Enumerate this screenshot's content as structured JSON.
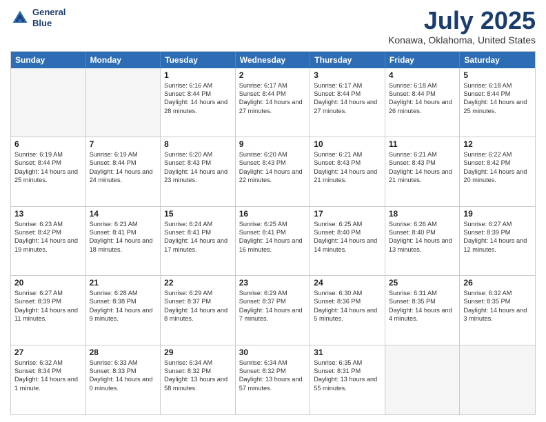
{
  "header": {
    "logo_line1": "General",
    "logo_line2": "Blue",
    "main_title": "July 2025",
    "subtitle": "Konawa, Oklahoma, United States"
  },
  "calendar": {
    "days_of_week": [
      "Sunday",
      "Monday",
      "Tuesday",
      "Wednesday",
      "Thursday",
      "Friday",
      "Saturday"
    ],
    "rows": [
      [
        {
          "day": "",
          "empty": true
        },
        {
          "day": "",
          "empty": true
        },
        {
          "day": "1",
          "sunrise": "Sunrise: 6:16 AM",
          "sunset": "Sunset: 8:44 PM",
          "daylight": "Daylight: 14 hours and 28 minutes."
        },
        {
          "day": "2",
          "sunrise": "Sunrise: 6:17 AM",
          "sunset": "Sunset: 8:44 PM",
          "daylight": "Daylight: 14 hours and 27 minutes."
        },
        {
          "day": "3",
          "sunrise": "Sunrise: 6:17 AM",
          "sunset": "Sunset: 8:44 PM",
          "daylight": "Daylight: 14 hours and 27 minutes."
        },
        {
          "day": "4",
          "sunrise": "Sunrise: 6:18 AM",
          "sunset": "Sunset: 8:44 PM",
          "daylight": "Daylight: 14 hours and 26 minutes."
        },
        {
          "day": "5",
          "sunrise": "Sunrise: 6:18 AM",
          "sunset": "Sunset: 8:44 PM",
          "daylight": "Daylight: 14 hours and 25 minutes."
        }
      ],
      [
        {
          "day": "6",
          "sunrise": "Sunrise: 6:19 AM",
          "sunset": "Sunset: 8:44 PM",
          "daylight": "Daylight: 14 hours and 25 minutes."
        },
        {
          "day": "7",
          "sunrise": "Sunrise: 6:19 AM",
          "sunset": "Sunset: 8:44 PM",
          "daylight": "Daylight: 14 hours and 24 minutes."
        },
        {
          "day": "8",
          "sunrise": "Sunrise: 6:20 AM",
          "sunset": "Sunset: 8:43 PM",
          "daylight": "Daylight: 14 hours and 23 minutes."
        },
        {
          "day": "9",
          "sunrise": "Sunrise: 6:20 AM",
          "sunset": "Sunset: 8:43 PM",
          "daylight": "Daylight: 14 hours and 22 minutes."
        },
        {
          "day": "10",
          "sunrise": "Sunrise: 6:21 AM",
          "sunset": "Sunset: 8:43 PM",
          "daylight": "Daylight: 14 hours and 21 minutes."
        },
        {
          "day": "11",
          "sunrise": "Sunrise: 6:21 AM",
          "sunset": "Sunset: 8:43 PM",
          "daylight": "Daylight: 14 hours and 21 minutes."
        },
        {
          "day": "12",
          "sunrise": "Sunrise: 6:22 AM",
          "sunset": "Sunset: 8:42 PM",
          "daylight": "Daylight: 14 hours and 20 minutes."
        }
      ],
      [
        {
          "day": "13",
          "sunrise": "Sunrise: 6:23 AM",
          "sunset": "Sunset: 8:42 PM",
          "daylight": "Daylight: 14 hours and 19 minutes."
        },
        {
          "day": "14",
          "sunrise": "Sunrise: 6:23 AM",
          "sunset": "Sunset: 8:41 PM",
          "daylight": "Daylight: 14 hours and 18 minutes."
        },
        {
          "day": "15",
          "sunrise": "Sunrise: 6:24 AM",
          "sunset": "Sunset: 8:41 PM",
          "daylight": "Daylight: 14 hours and 17 minutes."
        },
        {
          "day": "16",
          "sunrise": "Sunrise: 6:25 AM",
          "sunset": "Sunset: 8:41 PM",
          "daylight": "Daylight: 14 hours and 16 minutes."
        },
        {
          "day": "17",
          "sunrise": "Sunrise: 6:25 AM",
          "sunset": "Sunset: 8:40 PM",
          "daylight": "Daylight: 14 hours and 14 minutes."
        },
        {
          "day": "18",
          "sunrise": "Sunrise: 6:26 AM",
          "sunset": "Sunset: 8:40 PM",
          "daylight": "Daylight: 14 hours and 13 minutes."
        },
        {
          "day": "19",
          "sunrise": "Sunrise: 6:27 AM",
          "sunset": "Sunset: 8:39 PM",
          "daylight": "Daylight: 14 hours and 12 minutes."
        }
      ],
      [
        {
          "day": "20",
          "sunrise": "Sunrise: 6:27 AM",
          "sunset": "Sunset: 8:39 PM",
          "daylight": "Daylight: 14 hours and 11 minutes."
        },
        {
          "day": "21",
          "sunrise": "Sunrise: 6:28 AM",
          "sunset": "Sunset: 8:38 PM",
          "daylight": "Daylight: 14 hours and 9 minutes."
        },
        {
          "day": "22",
          "sunrise": "Sunrise: 6:29 AM",
          "sunset": "Sunset: 8:37 PM",
          "daylight": "Daylight: 14 hours and 8 minutes."
        },
        {
          "day": "23",
          "sunrise": "Sunrise: 6:29 AM",
          "sunset": "Sunset: 8:37 PM",
          "daylight": "Daylight: 14 hours and 7 minutes."
        },
        {
          "day": "24",
          "sunrise": "Sunrise: 6:30 AM",
          "sunset": "Sunset: 8:36 PM",
          "daylight": "Daylight: 14 hours and 5 minutes."
        },
        {
          "day": "25",
          "sunrise": "Sunrise: 6:31 AM",
          "sunset": "Sunset: 8:35 PM",
          "daylight": "Daylight: 14 hours and 4 minutes."
        },
        {
          "day": "26",
          "sunrise": "Sunrise: 6:32 AM",
          "sunset": "Sunset: 8:35 PM",
          "daylight": "Daylight: 14 hours and 3 minutes."
        }
      ],
      [
        {
          "day": "27",
          "sunrise": "Sunrise: 6:32 AM",
          "sunset": "Sunset: 8:34 PM",
          "daylight": "Daylight: 14 hours and 1 minute."
        },
        {
          "day": "28",
          "sunrise": "Sunrise: 6:33 AM",
          "sunset": "Sunset: 8:33 PM",
          "daylight": "Daylight: 14 hours and 0 minutes."
        },
        {
          "day": "29",
          "sunrise": "Sunrise: 6:34 AM",
          "sunset": "Sunset: 8:32 PM",
          "daylight": "Daylight: 13 hours and 58 minutes."
        },
        {
          "day": "30",
          "sunrise": "Sunrise: 6:34 AM",
          "sunset": "Sunset: 8:32 PM",
          "daylight": "Daylight: 13 hours and 57 minutes."
        },
        {
          "day": "31",
          "sunrise": "Sunrise: 6:35 AM",
          "sunset": "Sunset: 8:31 PM",
          "daylight": "Daylight: 13 hours and 55 minutes."
        },
        {
          "day": "",
          "empty": true
        },
        {
          "day": "",
          "empty": true
        }
      ]
    ]
  }
}
